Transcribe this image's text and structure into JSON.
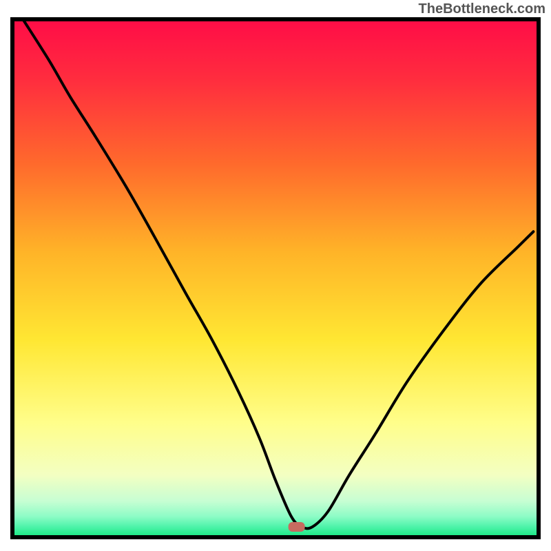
{
  "watermark": "TheBottleneck.com",
  "chart_data": {
    "type": "line",
    "title": "",
    "xlabel": "",
    "ylabel": "",
    "xlim": [
      0,
      100
    ],
    "ylim": [
      0,
      100
    ],
    "axes_visible": false,
    "background_gradient_top_to_bottom": [
      "#FF0C47",
      "#FF4A36",
      "#FFB428",
      "#FFE733",
      "#FFFE8B",
      "#E3FECE",
      "#73F9BE",
      "#15E880"
    ],
    "marker": {
      "x": 54,
      "y": 2,
      "color": "#C76B60",
      "shape": "rounded-rect"
    },
    "series": [
      {
        "name": "bottleneck-curve",
        "x": [
          2,
          7,
          11,
          16,
          22,
          27,
          33,
          38,
          43,
          47,
          50,
          53,
          55,
          57,
          60,
          64,
          69,
          75,
          82,
          89,
          96,
          99
        ],
        "values": [
          100,
          92,
          85,
          77,
          67,
          58,
          47,
          38,
          28,
          19,
          11,
          4,
          2,
          2,
          5,
          12,
          20,
          30,
          40,
          49,
          56,
          59
        ]
      }
    ],
    "interpretation_note": "Curve reaches near-zero (valley) around x≈54; rises toward 100 on left and ~59 on right."
  }
}
